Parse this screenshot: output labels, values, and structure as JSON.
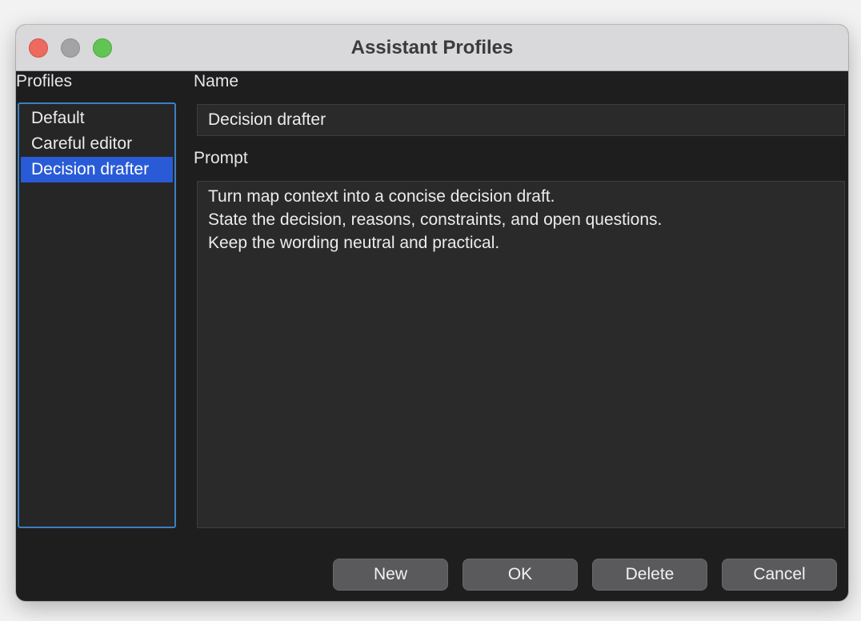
{
  "window": {
    "title": "Assistant Profiles"
  },
  "profiles": {
    "label": "Profiles",
    "items": [
      {
        "label": "Default",
        "selected": false
      },
      {
        "label": "Careful editor",
        "selected": false
      },
      {
        "label": "Decision drafter",
        "selected": true
      }
    ]
  },
  "name": {
    "label": "Name",
    "value": "Decision drafter"
  },
  "prompt": {
    "label": "Prompt",
    "lines": [
      "Turn map context into a concise decision draft.",
      "State the decision, reasons, constraints, and open questions.",
      "Keep the wording neutral and practical."
    ]
  },
  "buttons": {
    "new": "New",
    "ok": "OK",
    "delete": "Delete",
    "cancel": "Cancel"
  },
  "colors": {
    "selection": "#2a5bd7",
    "focus_ring": "#3b7fc4",
    "window_bg": "#1e1e1e",
    "titlebar_bg": "#d9d8da",
    "close": "#ed6a5e",
    "minimize": "#a3a3a6",
    "maximize": "#61c554"
  }
}
